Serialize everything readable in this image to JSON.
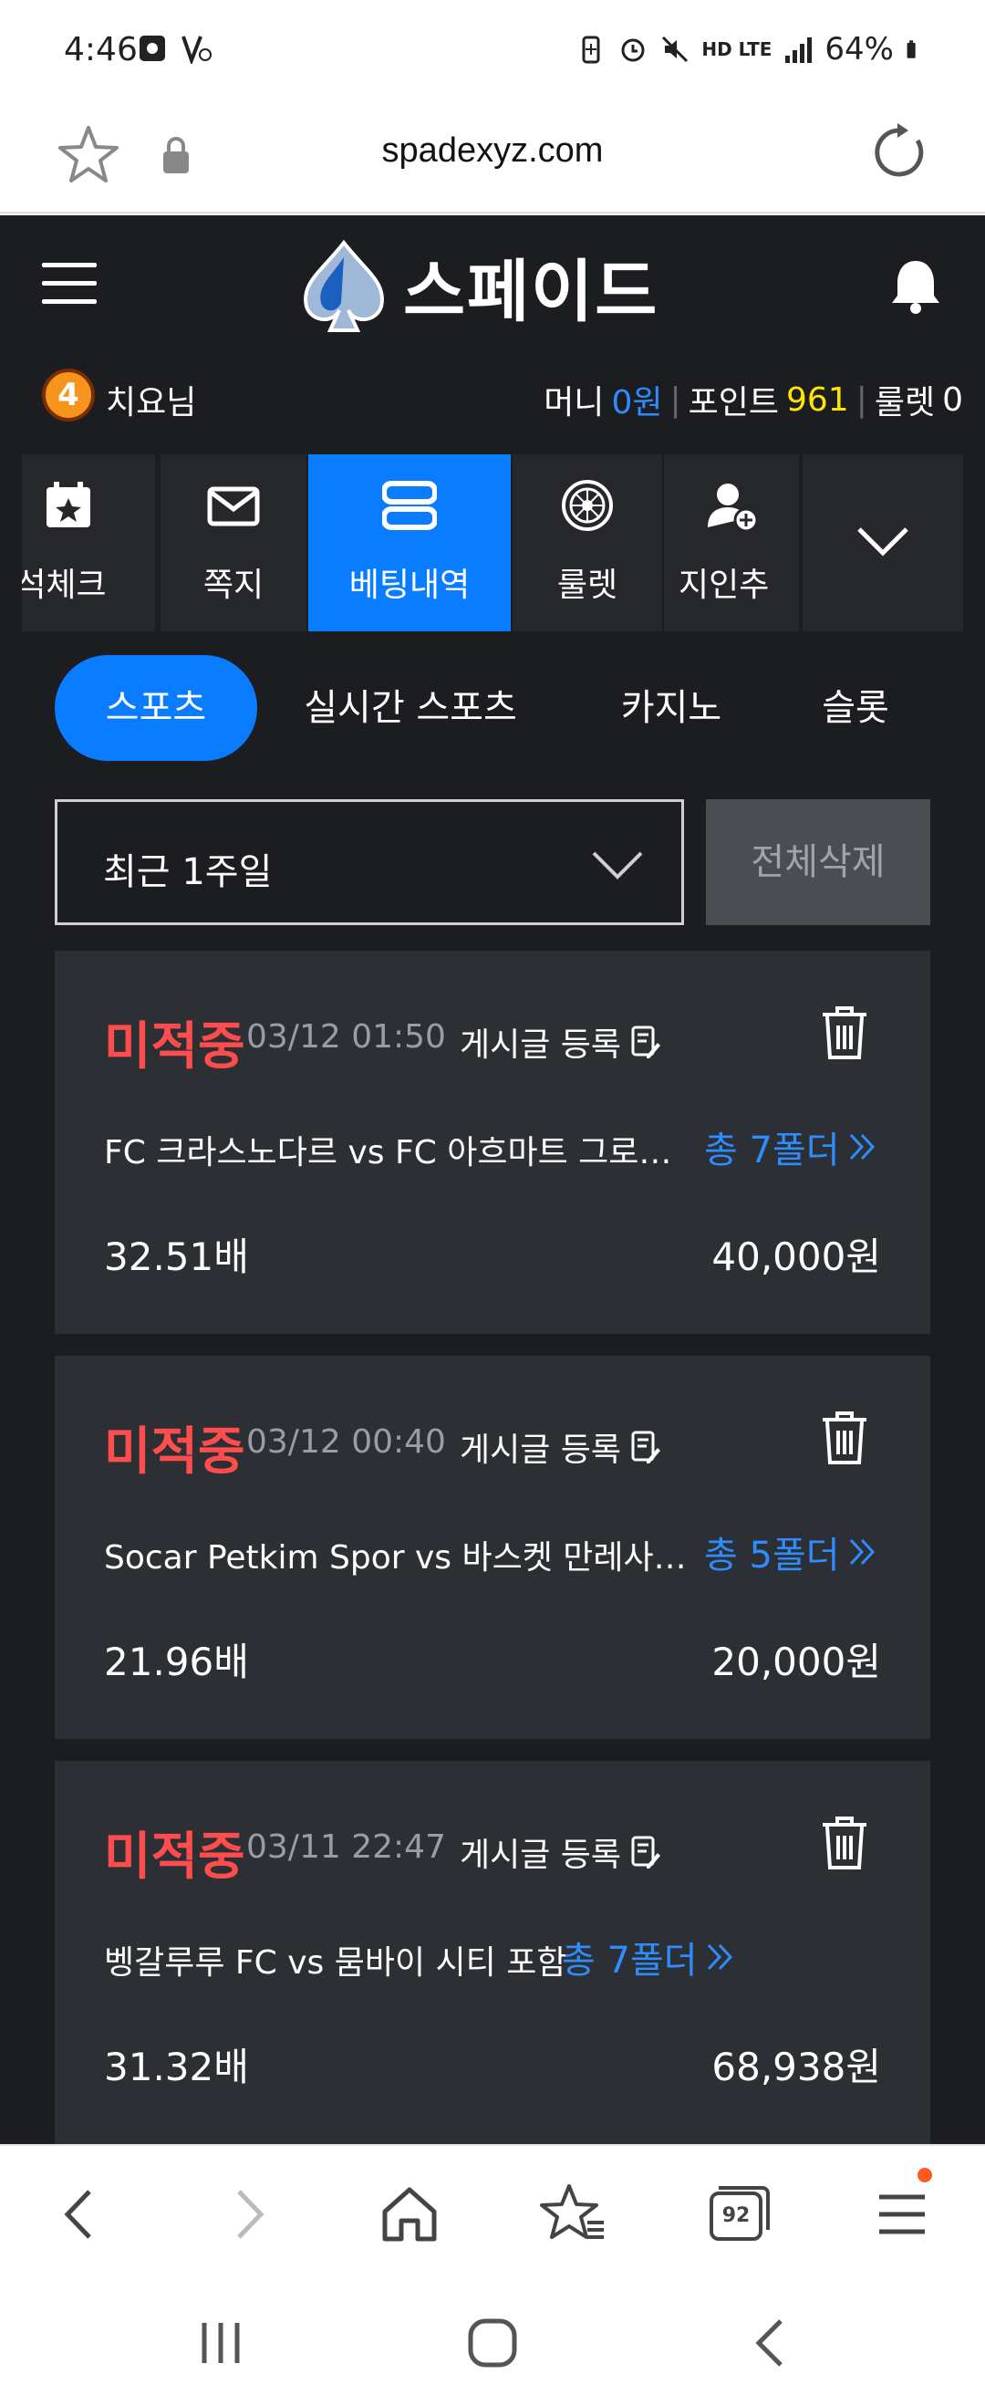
{
  "status_bar": {
    "time": "4:46",
    "network": "HD LTE",
    "battery": "64%"
  },
  "browser": {
    "url": "spadexyz.com"
  },
  "site": {
    "logo_text": "스페이드",
    "user": {
      "level": "4",
      "name": "치요님"
    },
    "wallet": {
      "money_label": "머니",
      "money_value": "0원",
      "point_label": "포인트",
      "point_value": "961",
      "roulette_label": "룰렛",
      "roulette_value": "0"
    },
    "quick_menu": [
      {
        "label": "석체크",
        "icon": "calendar-star-icon"
      },
      {
        "label": "쪽지",
        "icon": "mail-icon"
      },
      {
        "label": "베팅내역",
        "icon": "bet-history-icon",
        "active": true
      },
      {
        "label": "룰렛",
        "icon": "roulette-icon"
      },
      {
        "label": "지인추",
        "icon": "add-friend-icon"
      }
    ],
    "game_tabs": [
      {
        "label": "스포츠",
        "active": true
      },
      {
        "label": "실시간 스포츠"
      },
      {
        "label": "카지노"
      },
      {
        "label": "슬롯"
      }
    ],
    "filter": {
      "period": "최근 1주일",
      "delete_all": "전체삭제"
    },
    "bets": [
      {
        "status": "미적중",
        "date": "03/12 01:50",
        "post_label": "게시글 등록",
        "match": "FC 크라스노다르 vs FC 아흐마트 그로즈…",
        "folder": "총 7폴더",
        "odds": "32.51배",
        "amount": "40,000원"
      },
      {
        "status": "미적중",
        "date": "03/12 00:40",
        "post_label": "게시글 등록",
        "match": "Socar Petkim Spor vs 바스켓 만레사 …",
        "folder": "총 5폴더",
        "odds": "21.96배",
        "amount": "20,000원"
      },
      {
        "status": "미적중",
        "date": "03/11 22:47",
        "post_label": "게시글 등록",
        "match": "벵갈루루 FC vs 뭄바이 시티 포함",
        "folder": "총 7폴더",
        "odds": "31.32배",
        "amount": "68,938원"
      }
    ]
  },
  "browser_nav": {
    "tab_count": "92"
  },
  "colors": {
    "accent_blue": "#0a7cff",
    "lost_red": "#ff4c4c",
    "point_yellow": "#ffe500",
    "background": "#1b1d21",
    "card": "#2c2f34"
  }
}
